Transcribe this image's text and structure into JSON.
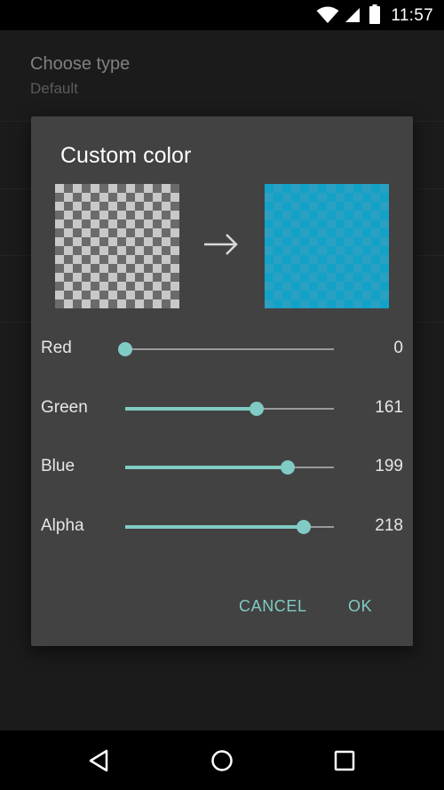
{
  "status_bar": {
    "time": "11:57",
    "icons": [
      "wifi-icon",
      "cellular-signal-icon",
      "battery-icon"
    ]
  },
  "settings": {
    "items": [
      {
        "title": "Choose type",
        "summary": "Default"
      }
    ]
  },
  "dialog": {
    "title": "Custom color",
    "preview": {
      "original_icon": "transparent-checkerboard",
      "arrow_icon": "arrow-right-icon",
      "new_color": "#13a2c7"
    },
    "sliders": [
      {
        "label": "Red",
        "value": "0",
        "numeric": 0,
        "max": 255
      },
      {
        "label": "Green",
        "value": "161",
        "numeric": 161,
        "max": 255
      },
      {
        "label": "Blue",
        "value": "199",
        "numeric": 199,
        "max": 255
      },
      {
        "label": "Alpha",
        "value": "218",
        "numeric": 218,
        "max": 255
      }
    ],
    "buttons": {
      "cancel": "CANCEL",
      "ok": "OK"
    },
    "accent_color": "#80cbc4"
  },
  "nav_bar": {
    "icons": [
      "back-icon",
      "home-icon",
      "recents-icon"
    ]
  }
}
